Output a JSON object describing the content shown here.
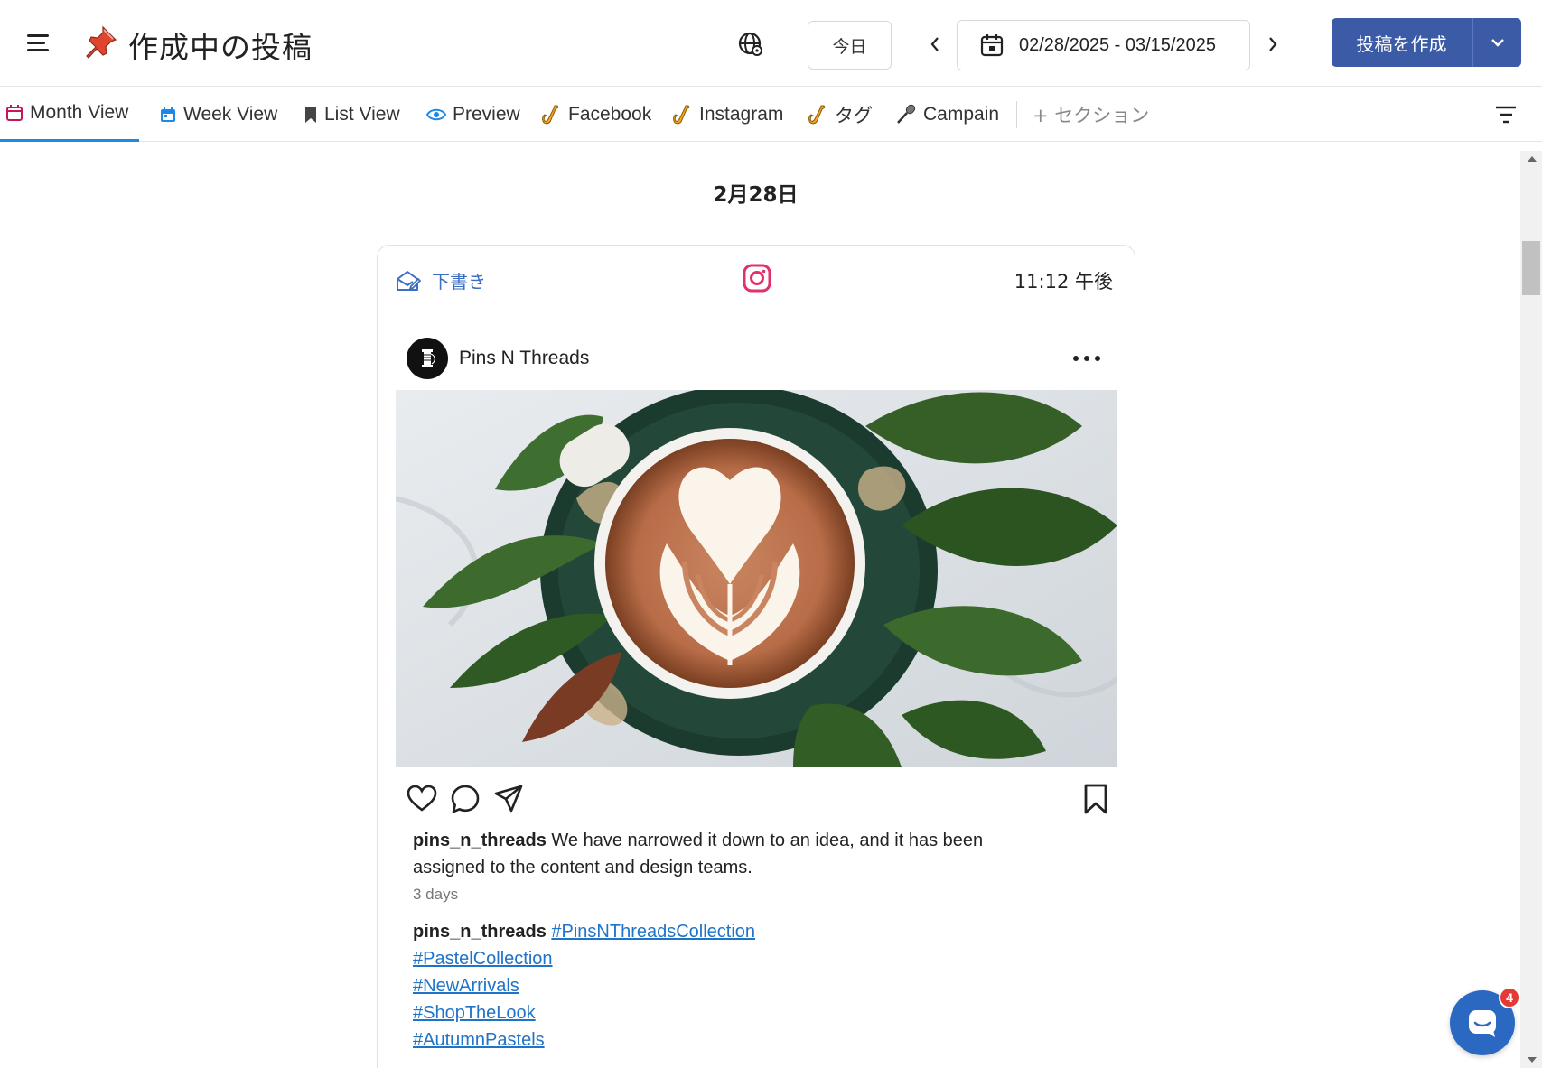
{
  "header": {
    "title": "作成中の投稿",
    "today_label": "今日",
    "date_range": "02/28/2025 - 03/15/2025",
    "create_label": "投稿を作成"
  },
  "tabs": [
    {
      "label": "Month View",
      "icon": "calendar-icon",
      "color": "#c2185b"
    },
    {
      "label": "Week View",
      "icon": "calendar-week-icon",
      "color": "#1e88e5"
    },
    {
      "label": "List View",
      "icon": "bookmark-icon",
      "color": "#444444"
    },
    {
      "label": "Preview",
      "icon": "eye-icon",
      "color": "#1e88e5"
    },
    {
      "label": "Facebook",
      "icon": "saxophone-icon",
      "color": "#f5a623"
    },
    {
      "label": "Instagram",
      "icon": "saxophone-icon",
      "color": "#f5a623"
    },
    {
      "label": "タグ",
      "icon": "saxophone-icon",
      "color": "#f5a623"
    },
    {
      "label": "Campain",
      "icon": "microphone-icon",
      "color": "#777777"
    }
  ],
  "add_section_label": "+ セクション",
  "day": {
    "heading": "2月28日"
  },
  "post": {
    "status": "下書き",
    "platform_icon": "instagram-icon",
    "time": "11:12 午後",
    "account_name": "Pins N Threads",
    "username": "pins_n_threads",
    "caption": "We have narrowed it down to an idea, and it has been assigned to the content and design teams.",
    "age": "3 days",
    "hashtags": [
      "#PinsNThreadsCollection",
      "#PastelCollection",
      "#NewArrivals",
      "#ShopTheLook",
      "#AutumnPastels"
    ]
  },
  "chat": {
    "badge_count": "4"
  },
  "colors": {
    "accent": "#3b5ba6",
    "active_tab": "#1e88e5",
    "link": "#1f73c9",
    "instagram": "#e1306c"
  }
}
